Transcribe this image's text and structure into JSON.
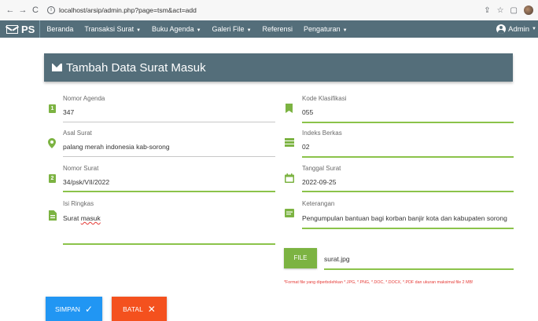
{
  "browser": {
    "url": "localhost/arsip/admin.php?page=tsm&act=add",
    "back_icon": "←",
    "forward_icon": "→",
    "reload_icon": "C"
  },
  "appbar": {
    "brand": "PS",
    "menu": [
      {
        "label": "Beranda",
        "has_caret": false
      },
      {
        "label": "Transaksi Surat",
        "has_caret": true
      },
      {
        "label": "Buku Agenda",
        "has_caret": true
      },
      {
        "label": "Galeri File",
        "has_caret": true
      },
      {
        "label": "Referensi",
        "has_caret": false
      },
      {
        "label": "Pengaturan",
        "has_caret": true
      }
    ],
    "caret": "▼",
    "user": "Admin",
    "user_caret": "▼"
  },
  "form": {
    "title": "Tambah Data Surat Masuk",
    "nomor_agenda": {
      "label": "Nomor Agenda",
      "value": "347",
      "icon_text": "1"
    },
    "asal_surat": {
      "label": "Asal Surat",
      "value": "palang merah indonesia kab-sorong"
    },
    "nomor_surat": {
      "label": "Nomor Surat",
      "value": "34/psk/VII/2022",
      "icon_text": "2"
    },
    "isi_ringkas": {
      "label": "Isi Ringkas",
      "value_prefix": "Surat ",
      "value_underlined": "masuk"
    },
    "kode_klasifikasi": {
      "label": "Kode Klasifikasi",
      "value": "055"
    },
    "indeks_berkas": {
      "label": "Indeks Berkas",
      "value": "02"
    },
    "tanggal_surat": {
      "label": "Tanggal Surat",
      "value": "2022-09-25"
    },
    "keterangan": {
      "label": "Keterangan",
      "value": "Pengumpulan bantuan bagi korban banjir kota dan kabupaten sorong"
    },
    "file": {
      "button": "FILE",
      "value": "surat.jpg"
    },
    "hint": "*Format file yang diperbolehkan *.JPG, *.PNG, *.DOC, *.DOCX, *.PDF dan ukuran maksimal file 2 MB!",
    "save_label": "SIMPAN",
    "save_icon": "✓",
    "cancel_label": "BATAL",
    "cancel_icon": "✕"
  },
  "colors": {
    "appbar": "#546e7a",
    "accent_green": "#7cb342",
    "save_blue": "#2196f3",
    "cancel_orange": "#f4511e",
    "hint_red": "#e53935"
  }
}
